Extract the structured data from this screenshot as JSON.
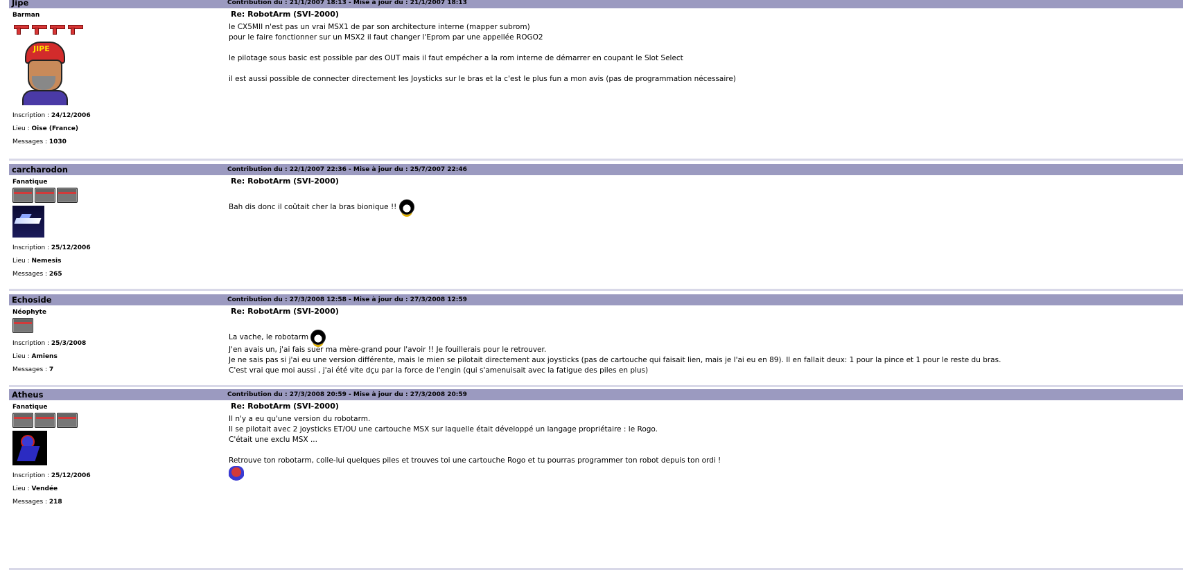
{
  "posts": [
    {
      "author": "Jipe",
      "dates": "Contribution du : 21/1/2007 18:13  - Mise à jour du : 21/1/2007 18:13",
      "rank": "Barman",
      "rank_icon": "gun-icon",
      "rank_icon_count": 4,
      "avatar": "avatar-jipe",
      "avatar_cap_text": "JIPE",
      "inscription_label": "Inscription : ",
      "inscription": "24/12/2006",
      "lieu_label": "Lieu : ",
      "lieu": "Oise (France)",
      "messages_label": "Messages : ",
      "messages": "1030",
      "subject": "Re: RobotArm (SVI-2000)",
      "lines": [
        "le CX5MII n'est pas un vrai MSX1 de par son architecture interne (mapper subrom)",
        "pour le faire fonctionner sur un MSX2 il faut changer l'Eprom par une appellée ROGO2",
        "",
        "le pilotage sous basic est possible par des OUT mais il faut empécher a la rom interne de démarrer en coupant le Slot Select",
        "",
        "il est aussi possible de connecter directement les Joysticks sur le bras et la c'est le plus fun a mon avis (pas de programmation nécessaire)"
      ]
    },
    {
      "author": "carcharodon",
      "dates": "Contribution du : 22/1/2007 22:36  - Mise à jour du : 25/7/2007 22:46",
      "rank": "Fanatique",
      "rank_icon": "box-icon",
      "rank_icon_count": 3,
      "avatar": "avatar-jet",
      "inscription_label": "Inscription : ",
      "inscription": "25/12/2006",
      "lieu_label": "Lieu : ",
      "lieu": "Nemesis",
      "messages_label": "Messages : ",
      "messages": "265",
      "subject": "Re: RobotArm (SVI-2000)",
      "lines": [
        "",
        "Bah dis donc il coûtait cher la bras bionique !! "
      ]
    },
    {
      "author": "Echoside",
      "dates": "Contribution du : 27/3/2008 12:58  - Mise à jour du : 27/3/2008 12:59",
      "rank": "Néophyte",
      "rank_icon": "box-icon",
      "rank_icon_count": 1,
      "avatar": "",
      "inscription_label": "Inscription : ",
      "inscription": "25/3/2008",
      "lieu_label": "Lieu : ",
      "lieu": "Amiens",
      "messages_label": "Messages : ",
      "messages": "7",
      "subject": "Re: RobotArm (SVI-2000)",
      "lines": [
        "",
        "La vache, le robotarm ",
        "J'en avais un, j'ai fais suer ma mère-grand pour l'avoir !! Je fouillerais pour le retrouver.",
        "Je ne sais pas si j'ai eu une version différente, mais le mien se pilotait directement aux joysticks (pas de cartouche qui faisait lien, mais je l'ai eu en 89). Il en fallait deux: 1 pour la pince et 1 pour le reste du bras.",
        "C'est vrai que moi aussi , j'ai été vite dçu par la force de l'engin (qui s'amenuisait avec la fatigue des piles en plus)"
      ]
    },
    {
      "author": "Atheus",
      "dates": "Contribution du : 27/3/2008 20:59  - Mise à jour du : 27/3/2008 20:59",
      "rank": "Fanatique",
      "rank_icon": "box-icon",
      "rank_icon_count": 3,
      "avatar": "avatar-ninja",
      "inscription_label": "Inscription : ",
      "inscription": "25/12/2006",
      "lieu_label": "Lieu : ",
      "lieu": "Vendée",
      "messages_label": "Messages : ",
      "messages": "218",
      "subject": "Re: RobotArm (SVI-2000)",
      "lines": [
        "Il n'y a eu qu'une version du robotarm.",
        "Il se pilotait avec 2 joysticks ET/OU une cartouche MSX sur laquelle était développé un langage propriétaire : le Rogo.",
        "C'était une exclu MSX ...",
        "",
        "Retrouve ton robotarm, colle-lui quelques piles et trouves toi une cartouche Rogo et tu pourras programmer ton robot depuis ton ordi !"
      ]
    }
  ]
}
